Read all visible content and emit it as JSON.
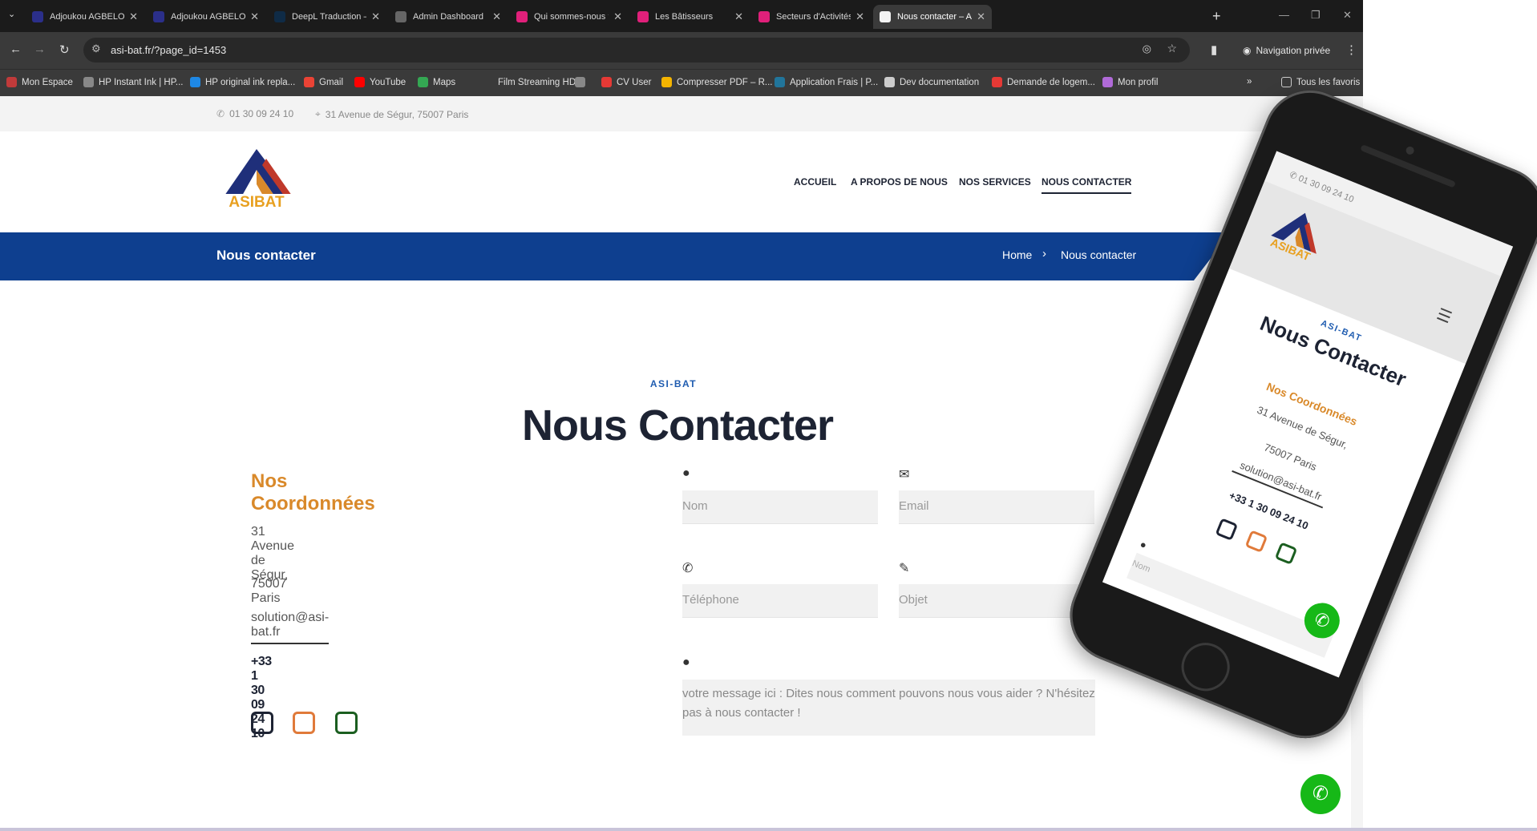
{
  "browser": {
    "tabs": [
      {
        "label": "Adjoukou AGBELOU Blog",
        "color": "#2b2f8a"
      },
      {
        "label": "Adjoukou AGBELOU Blog",
        "color": "#2b2f8a"
      },
      {
        "label": "DeepL Traduction – DeepL",
        "color": "#0f2b46"
      },
      {
        "label": "Admin Dashboard",
        "color": "#666666"
      },
      {
        "label": "Qui sommes-nous ? Les Bâ",
        "color": "#e0207a"
      },
      {
        "label": "Les Bâtisseurs",
        "color": "#e0207a"
      },
      {
        "label": "Secteurs d'Activités Les Bâ",
        "color": "#e0207a"
      },
      {
        "label": "Nous contacter – ASI-BAT",
        "color": "#f3f3f3",
        "active": true
      }
    ],
    "url": "asi-bat.fr/?page_id=1453",
    "private_label": "Navigation privée",
    "bookmarks": [
      {
        "label": "Mon Espace",
        "color": "#c03a3a"
      },
      {
        "label": "HP Instant Ink | HP...",
        "color": "#888888"
      },
      {
        "label": "HP original ink repla...",
        "color": "#1e88e5"
      },
      {
        "label": "Gmail",
        "color": "#ea4335"
      },
      {
        "label": "YouTube",
        "color": "#ff0000"
      },
      {
        "label": "Maps",
        "color": "#34a853"
      },
      {
        "label": "Film Streaming HD...",
        "color": "#3a3a3a"
      },
      {
        "label": "",
        "color": "#888888"
      },
      {
        "label": "CV User",
        "color": "#e53935"
      },
      {
        "label": "Compresser PDF – R...",
        "color": "#f4b400"
      },
      {
        "label": "Application Frais | P...",
        "color": "#21759b"
      },
      {
        "label": "Dev documentation",
        "color": "#cccccc"
      },
      {
        "label": "Demande de logem...",
        "color": "#e53935"
      },
      {
        "label": "Mon profil",
        "color": "#b06ad8"
      }
    ],
    "all_bookmarks": "Tous les favoris"
  },
  "site": {
    "phone_top": "01 30 09 24 10",
    "address_top": "31 Avenue de Ségur, 75007 Paris",
    "nav": [
      "ACCUEIL",
      "A PROPOS DE NOUS",
      "NOS SERVICES",
      "NOUS CONTACTER"
    ],
    "banner_title": "Nous contacter",
    "breadcrumb_home": "Home",
    "breadcrumb_current": "Nous contacter",
    "eyebrow": "ASI-BAT",
    "heading": "Nous Contacter",
    "coord_title": "Nos Coordonnées",
    "address_line1": "31 Avenue de Ségur,",
    "address_line2": "75007 Paris",
    "email": "solution@asi-bat.fr",
    "phone": "+33 1 30 09 24 10",
    "form": {
      "name_placeholder": "Nom",
      "email_placeholder": "Email",
      "phone_placeholder": "Téléphone",
      "subject_placeholder": "Objet",
      "message_placeholder": "votre message ici : Dites nous comment pouvons nous vous aider ? N'hésitez pas à nous contacter !"
    },
    "logo_text": "ASIBAT",
    "colors": {
      "primary": "#0e3f8f",
      "accent": "#d9892a",
      "call": "#16b817"
    }
  },
  "mobile": {
    "phone_top": "01 30 09 24 10",
    "eyebrow": "ASI-BAT",
    "heading": "Nous Contacter",
    "coord_title": "Nos Coordonnées",
    "address_line1": "31 Avenue de Ségur,",
    "address_line2": "75007 Paris",
    "email": "solution@asi-bat.fr",
    "phone": "+33 1 30 09 24 10",
    "name_placeholder": "Nom"
  }
}
